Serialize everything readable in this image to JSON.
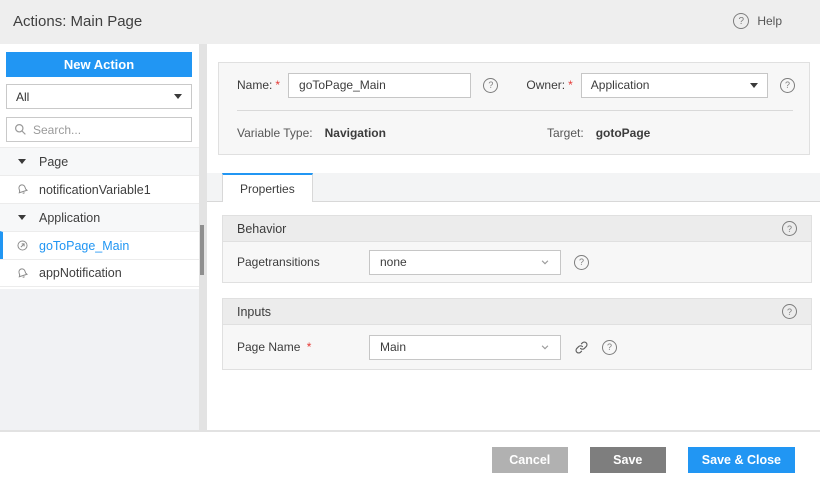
{
  "header": {
    "title": "Actions: Main Page",
    "help_label": "Help"
  },
  "sidebar": {
    "new_action_label": "New Action",
    "filter_value": "All",
    "search_placeholder": "Search...",
    "tree": [
      {
        "type": "group",
        "label": "Page",
        "expanded": true
      },
      {
        "type": "item",
        "label": "notificationVariable1",
        "icon": "notification-bell-icon",
        "selected": false
      },
      {
        "type": "group",
        "label": "Application",
        "expanded": true
      },
      {
        "type": "item",
        "label": "goToPage_Main",
        "icon": "navigation-action-icon",
        "selected": true
      },
      {
        "type": "item",
        "label": "appNotification",
        "icon": "notification-bell-icon",
        "selected": false
      }
    ]
  },
  "form": {
    "required_marker": "*",
    "name_label": "Name:",
    "name_value": "goToPage_Main",
    "owner_label": "Owner:",
    "owner_value": "Application",
    "variable_type_label": "Variable Type:",
    "variable_type_value": "Navigation",
    "target_label": "Target:",
    "target_value": "gotoPage"
  },
  "tabs": [
    {
      "label": "Properties",
      "active": true
    }
  ],
  "sections": {
    "behavior": {
      "title": "Behavior",
      "field_label": "Pagetransitions",
      "field_value": "none"
    },
    "inputs": {
      "title": "Inputs",
      "field_label": "Page Name",
      "field_required": "*",
      "field_value": "Main"
    }
  },
  "footer": {
    "cancel_label": "Cancel",
    "save_label": "Save",
    "save_close_label": "Save & Close"
  },
  "colors": {
    "accent_blue": "#2196f3",
    "required_red": "#e53935",
    "header_bg": "#eeeeee",
    "panel_bg": "#f7f7f7",
    "section_header_bg": "#ececec",
    "cancel_btn": "#b1b1b1",
    "save_btn": "#7e7e7e"
  }
}
